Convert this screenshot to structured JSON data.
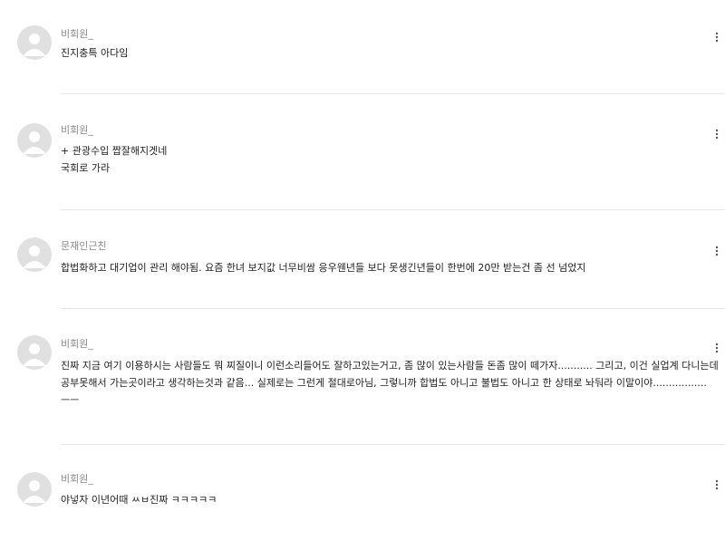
{
  "comments": [
    {
      "author": "비회원_",
      "text": "진지충특 아다임"
    },
    {
      "author": "비회원_",
      "text": "+ 관광수입 짭잘해지겟네\n국회로 가라"
    },
    {
      "author": "문재인근친",
      "text": "합법화하고 대기업이 관리 해야됨. 요즘 한녀 보지값 너무비쌈 응우웬년들 보다 못생긴년들이 한번에 20만 받는건 좀 선 넘었지"
    },
    {
      "author": "비회원_",
      "text": "진짜 지금 여기 이용하시는 사람들도 뭐 찌질이니 이런소리들어도 잘하고있는거고, 좀 많이 있는사람들 돈좀 많이 떼가자........... 그리고, 이건 실업계 다니는데 공부못해서 가는곳이라고 생각하는것과 같음... 실제로는 그런게 절대로아님, 그렇니까 합법도 아니고 불법도 아니고 한 상태로 놔둬라 이말이야.................ㅡㅡ"
    },
    {
      "author": "비회원_",
      "text": "야넣자 이년어때 ㅆㅂ진짜 ㅋㅋㅋㅋㅋ"
    }
  ],
  "icons": {
    "avatar": "default-user-avatar-icon",
    "menu": "more-vertical-icon"
  },
  "colors": {
    "author": "#8a8a8a",
    "text": "#222222",
    "avatar_bg": "#e0e0e0",
    "avatar_fg": "#ffffff",
    "divider": "#e6e6e6"
  }
}
